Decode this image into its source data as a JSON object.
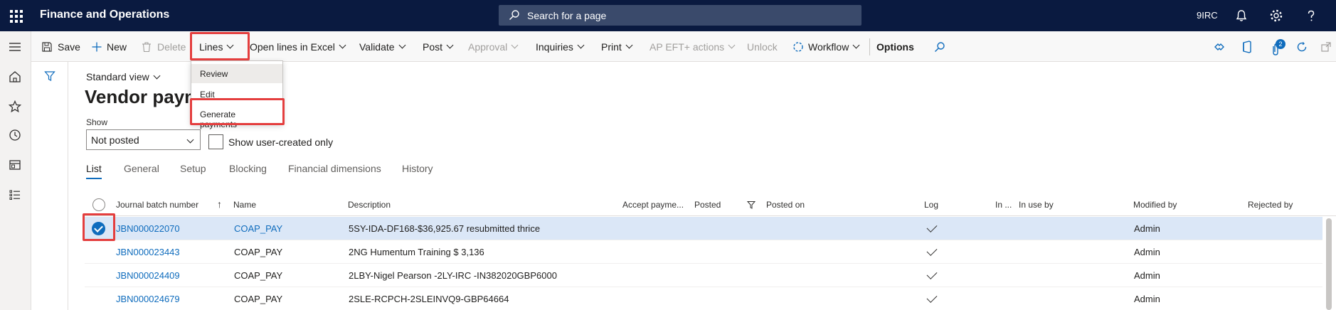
{
  "topbar": {
    "app_title": "Finance and Operations",
    "search_placeholder": "Search for a page",
    "company": "9IRC",
    "notification_badge": "2"
  },
  "actionpane": {
    "save": "Save",
    "new": "New",
    "delete": "Delete",
    "lines": "Lines",
    "open_lines_excel": "Open lines in Excel",
    "validate": "Validate",
    "post": "Post",
    "approval": "Approval",
    "inquiries": "Inquiries",
    "print": "Print",
    "ap_eft": "AP EFT+ actions",
    "unlock": "Unlock",
    "workflow": "Workflow",
    "options": "Options"
  },
  "lines_menu": {
    "items": [
      "Review",
      "Edit",
      "Generate payments"
    ]
  },
  "page": {
    "view_name": "Standard view",
    "title": "Vendor payme",
    "show_label": "Show",
    "show_value": "Not posted",
    "user_created_label": "Show user-created only"
  },
  "tabs": [
    "List",
    "General",
    "Setup",
    "Blocking",
    "Financial dimensions",
    "History"
  ],
  "grid": {
    "columns": {
      "journal_batch": "Journal batch number",
      "sort_indicator": "↑",
      "name": "Name",
      "description": "Description",
      "accept_payment": "Accept payme...",
      "posted": "Posted",
      "posted_on": "Posted on",
      "log": "Log",
      "in_use": "In ...",
      "in_use_by": "In use by",
      "modified_by": "Modified by",
      "rejected_by": "Rejected by"
    },
    "rows": [
      {
        "journal": "JBN000022070",
        "name": "COAP_PAY",
        "description": "5SY-IDA-DF168-$36,925.67 resubmitted thrice",
        "modified_by": "Admin",
        "selected": true
      },
      {
        "journal": "JBN000023443",
        "name": "COAP_PAY",
        "description": "2NG Humentum Training $ 3,136",
        "modified_by": "Admin",
        "selected": false
      },
      {
        "journal": "JBN000024409",
        "name": "COAP_PAY",
        "description": "2LBY-Nigel Pearson -2LY-IRC -IN382020GBP6000",
        "modified_by": "Admin",
        "selected": false
      },
      {
        "journal": "JBN000024679",
        "name": "COAP_PAY",
        "description": "2SLE-RCPCH-2SLEINVQ9-GBP64664",
        "modified_by": "Admin",
        "selected": false
      }
    ]
  },
  "colors": {
    "topbar": "#0a1a40",
    "link": "#0f6cbd",
    "highlight_box": "#e43e3e",
    "selected_row": "#dbe7f7"
  }
}
